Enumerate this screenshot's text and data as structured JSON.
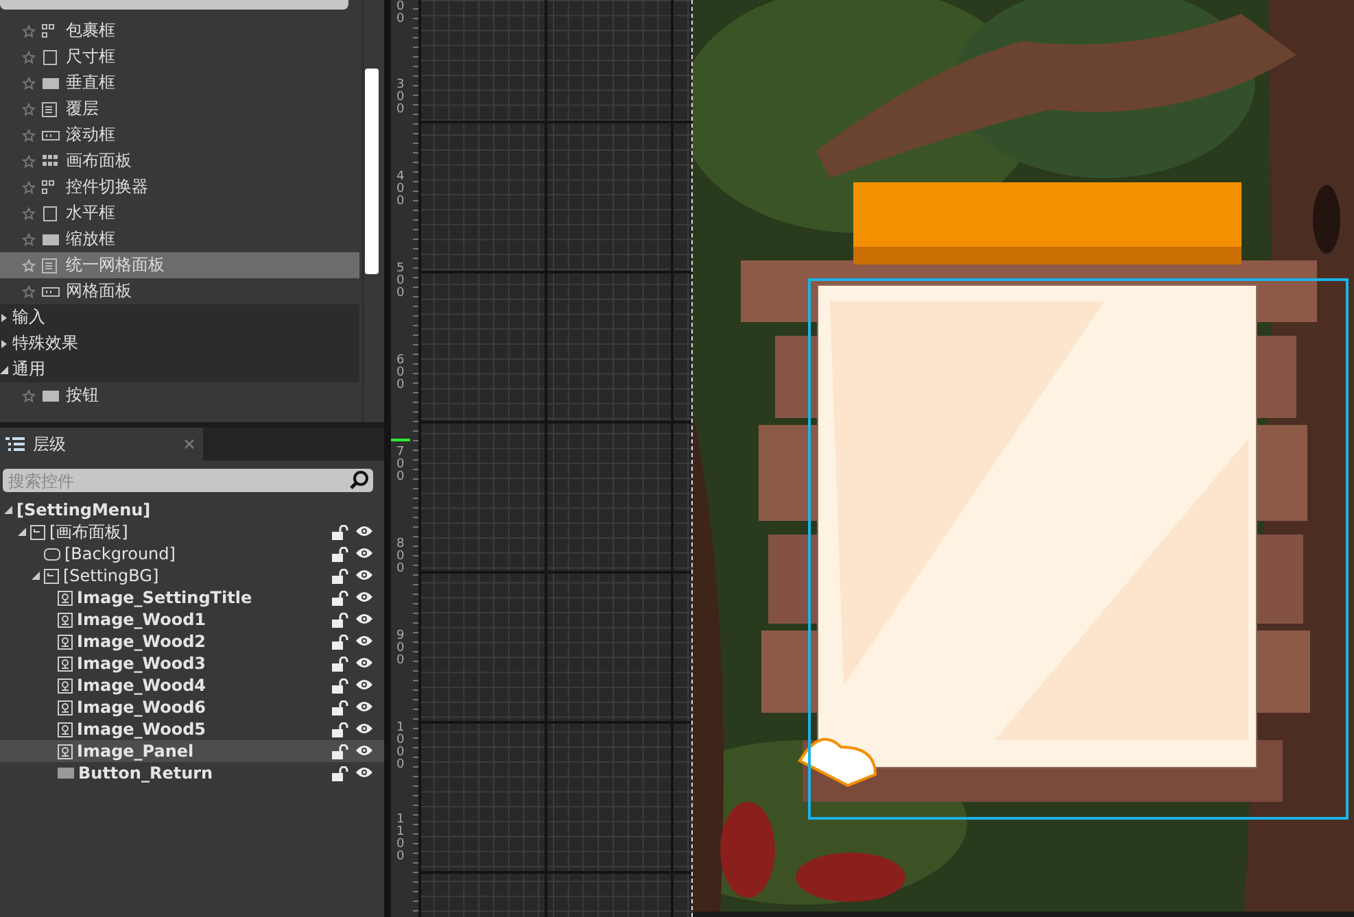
{
  "palette": {
    "items": [
      {
        "label": "包裹框",
        "selected": false
      },
      {
        "label": "尺寸框",
        "selected": false
      },
      {
        "label": "垂直框",
        "selected": false
      },
      {
        "label": "覆层",
        "selected": false
      },
      {
        "label": "滚动框",
        "selected": false
      },
      {
        "label": "画布面板",
        "selected": false
      },
      {
        "label": "控件切换器",
        "selected": false
      },
      {
        "label": "水平框",
        "selected": false
      },
      {
        "label": "缩放框",
        "selected": false
      },
      {
        "label": "统一网格面板",
        "selected": true
      },
      {
        "label": "网格面板",
        "selected": false
      }
    ],
    "categories": [
      {
        "label": "输入",
        "expanded": false
      },
      {
        "label": "特殊效果",
        "expanded": false
      },
      {
        "label": "通用",
        "expanded": true,
        "items": [
          {
            "label": "按钮",
            "selected": false
          }
        ]
      }
    ]
  },
  "hierarchy": {
    "tab": {
      "label": "层级",
      "selected": true
    },
    "search": {
      "placeholder": "搜索控件"
    },
    "tree": [
      {
        "label": "[SettingMenu]",
        "kind": "root",
        "bold": true,
        "selected": false,
        "expanded": true,
        "children": [
          {
            "label": "[画布面板]",
            "kind": "canvas",
            "bold": false,
            "selected": false,
            "expanded": true,
            "children": [
              {
                "label": "[Background]",
                "kind": "border",
                "bold": false,
                "selected": false
              },
              {
                "label": "[SettingBG]",
                "kind": "canvas",
                "bold": false,
                "selected": false,
                "expanded": true,
                "children": [
                  {
                    "label": "Image_SettingTitle",
                    "kind": "image",
                    "bold": true,
                    "selected": false
                  },
                  {
                    "label": "Image_Wood1",
                    "kind": "image",
                    "bold": true,
                    "selected": false
                  },
                  {
                    "label": "Image_Wood2",
                    "kind": "image",
                    "bold": true,
                    "selected": false
                  },
                  {
                    "label": "Image_Wood3",
                    "kind": "image",
                    "bold": true,
                    "selected": false
                  },
                  {
                    "label": "Image_Wood4",
                    "kind": "image",
                    "bold": true,
                    "selected": false
                  },
                  {
                    "label": "Image_Wood6",
                    "kind": "image",
                    "bold": true,
                    "selected": false
                  },
                  {
                    "label": "Image_Wood5",
                    "kind": "image",
                    "bold": true,
                    "selected": false
                  },
                  {
                    "label": "Image_Panel",
                    "kind": "image",
                    "bold": true,
                    "selected": true
                  },
                  {
                    "label": "Button_Return",
                    "kind": "button",
                    "bold": true,
                    "selected": false
                  }
                ]
              }
            ]
          }
        ]
      }
    ]
  },
  "canvas": {
    "ruler_labels": [
      "00",
      "300",
      "400",
      "500",
      "600",
      "700",
      "800",
      "900",
      "1000",
      "1100"
    ]
  }
}
